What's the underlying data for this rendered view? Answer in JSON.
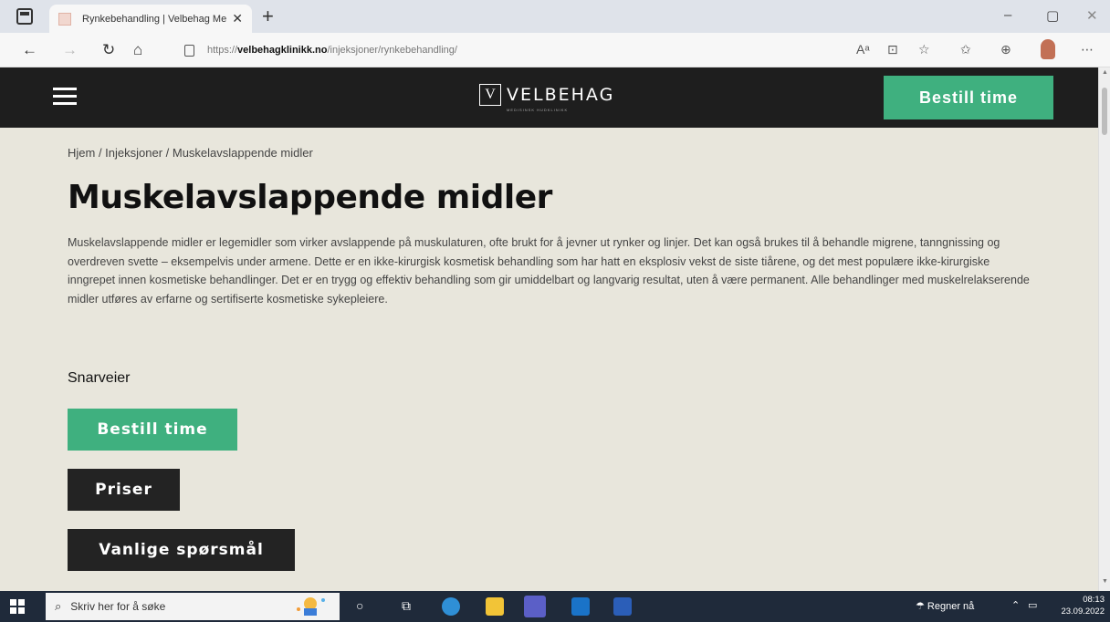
{
  "browser": {
    "tab_title": "Rynkebehandling | Velbehag Me",
    "tab_close": "✕",
    "new_tab": "+",
    "url_prefix": "https://",
    "url_domain": "velbehagklinikk.no",
    "url_path": "/injeksjoner/rynkebehandling/",
    "window": {
      "minimize": "–",
      "maximize": "▢",
      "close": "✕"
    },
    "nav": {
      "back": "←",
      "forward": "→",
      "reload": "↻",
      "home": "⌂"
    },
    "tools": [
      "A͏ᵃ",
      "⊡",
      "☆",
      "✩",
      "⊕",
      "⋯"
    ]
  },
  "header": {
    "logo_mark": "V",
    "logo_text": "VELBEHAG",
    "logo_sub": "MEDISINSK HUDKLINIKK",
    "cta_label": "Bestill time"
  },
  "main": {
    "breadcrumb": "Hjem / Injeksjoner / Muskelavslappende midler",
    "title": "Muskelavslappende midler",
    "intro": "Muskelavslappende midler er legemidler som virker avslappende på muskulaturen, ofte brukt for å jevner ut rynker og linjer. Det kan også brukes til å behandle migrene, tanngnissing og overdreven svette – eksempelvis under armene. Dette er en ikke-kirurgisk kosmetisk behandling som har hatt en eksplosiv vekst de siste tiårene, og det mest populære ikke-kirurgiske inngrepet innen kosmetiske behandlinger. Det er en trygg og effektiv behandling som gir umiddelbart og langvarig resultat, uten å være permanent. Alle behandlinger med muskelrelakserende midler utføres av erfarne og sertifiserte kosmetiske sykepleiere.",
    "shortcuts_heading": "Snarveier",
    "shortcuts": {
      "book": "Bestill time",
      "prices": "Priser",
      "faq": "Vanlige spørsmål"
    }
  },
  "taskbar": {
    "search_placeholder": "Skriv her for å søke",
    "weather": "Regner nå",
    "time": "08:13",
    "date": "23.09.2022"
  },
  "colors": {
    "accent_green": "#3fb07f",
    "header_bg": "#1e1e1e",
    "page_bg": "#e8e6dc",
    "taskbar_bg": "#1f2a3a"
  }
}
